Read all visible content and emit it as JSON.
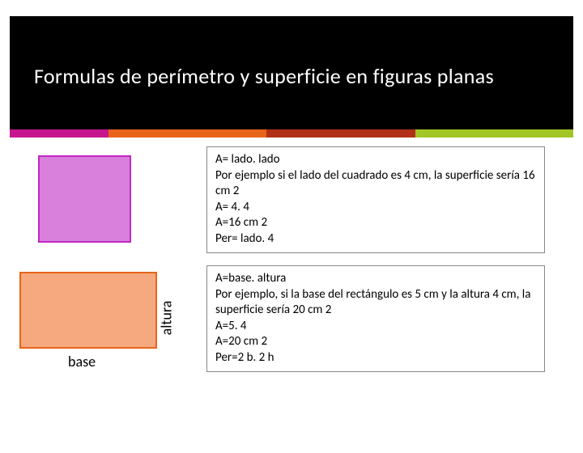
{
  "title": "Formulas de perímetro y  superficie en figuras planas",
  "labels": {
    "altura": "altura",
    "base": "base"
  },
  "square_box": {
    "l1": "A= lado. lado",
    "l2": "Por ejemplo si el lado del cuadrado es 4 cm, la superficie sería 16 cm 2",
    "l3": "A= 4. 4",
    "l4": "A=16 cm 2",
    "l5": "Per= lado. 4"
  },
  "rect_box": {
    "l1": "A=base. altura",
    "l2": "Por ejemplo, si la base del rectángulo es 5 cm y la altura 4 cm, la superficie sería 20 cm 2",
    "l3": "A=5. 4",
    "l4": "A=20 cm 2",
    "l5": "Per=2 b. 2 h"
  }
}
